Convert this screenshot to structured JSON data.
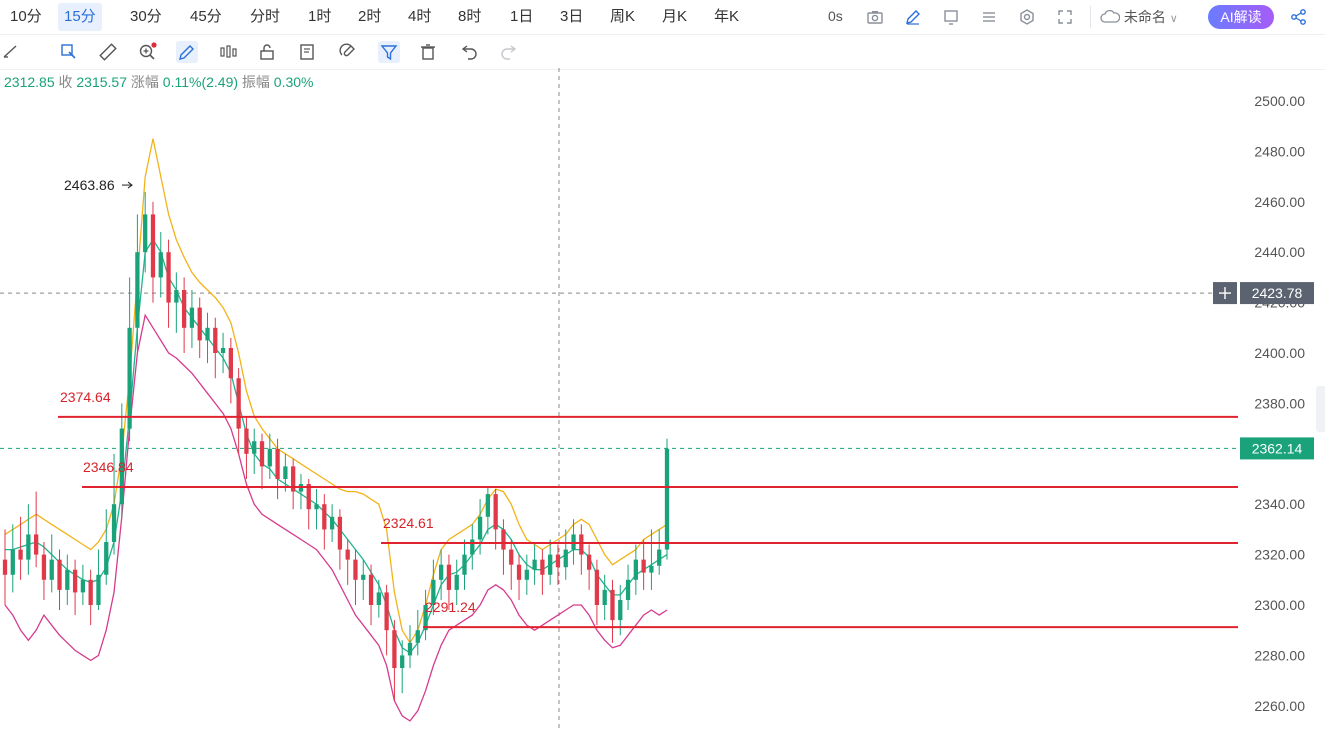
{
  "periods": [
    "10分",
    "15分",
    "30分",
    "45分",
    "分时",
    "1时",
    "2时",
    "4时",
    "8时",
    "1日",
    "3日",
    "周K",
    "月K",
    "年K"
  ],
  "active_period": "15分",
  "topbar": {
    "seconds": "0s",
    "layout_name": "未命名",
    "ai_button": "AI解读"
  },
  "info": {
    "open_value": "2312.85",
    "close_label": "收",
    "close_value": "2315.57",
    "change_label": "涨幅",
    "change_value": "0.11%(2.49)",
    "amp_label": "振幅",
    "amp_value": "0.30%"
  },
  "icons": {
    "toolbar": [
      "pointer-icon",
      "ruler-icon",
      "zoom-in-icon",
      "draw-pen-icon",
      "candle-type-icon",
      "lock-icon",
      "edit-list-icon",
      "magnet-icon",
      "filter-icon",
      "trash-icon",
      "undo-icon",
      "redo-icon"
    ],
    "topbar": [
      "camera-icon",
      "pen-icon",
      "screen-icon",
      "list-icon",
      "settings-icon",
      "fullscreen-icon",
      "cloud-icon",
      "share-icon"
    ]
  },
  "chart_data": {
    "type": "candlestick",
    "y_ticks": [
      "2500.00",
      "2480.00",
      "2460.00",
      "2440.00",
      "2420.00",
      "2400.00",
      "2380.00",
      "2360.00",
      "2340.00",
      "2320.00",
      "2300.00",
      "2280.00",
      "2260.00"
    ],
    "ylim": [
      2251,
      2514
    ],
    "current_price": "2362.14",
    "crosshair_price": "2423.78",
    "max_label": "2463.86",
    "levels": [
      {
        "value": 2374.64,
        "label": "2374.64"
      },
      {
        "value": 2346.84,
        "label": "2346.84"
      },
      {
        "value": 2324.61,
        "label": "2324.61"
      },
      {
        "value": 2291.24,
        "label": "2291.24"
      }
    ],
    "candles": [
      [
        2318,
        2312,
        2330,
        2300
      ],
      [
        2312,
        2322,
        2332,
        2305
      ],
      [
        2322,
        2318,
        2335,
        2310
      ],
      [
        2318,
        2328,
        2340,
        2312
      ],
      [
        2328,
        2320,
        2345,
        2315
      ],
      [
        2320,
        2310,
        2325,
        2302
      ],
      [
        2310,
        2318,
        2328,
        2305
      ],
      [
        2318,
        2306,
        2322,
        2298
      ],
      [
        2306,
        2314,
        2320,
        2300
      ],
      [
        2314,
        2305,
        2318,
        2296
      ],
      [
        2305,
        2310,
        2316,
        2300
      ],
      [
        2310,
        2300,
        2314,
        2292
      ],
      [
        2300,
        2312,
        2322,
        2298
      ],
      [
        2312,
        2325,
        2338,
        2308
      ],
      [
        2325,
        2340,
        2360,
        2320
      ],
      [
        2340,
        2370,
        2380,
        2335
      ],
      [
        2370,
        2410,
        2430,
        2365
      ],
      [
        2410,
        2440,
        2455,
        2400
      ],
      [
        2440,
        2455,
        2463.86,
        2432
      ],
      [
        2455,
        2430,
        2460,
        2420
      ],
      [
        2430,
        2440,
        2448,
        2422
      ],
      [
        2440,
        2420,
        2445,
        2410
      ],
      [
        2420,
        2425,
        2432,
        2408
      ],
      [
        2425,
        2410,
        2430,
        2400
      ],
      [
        2410,
        2418,
        2425,
        2402
      ],
      [
        2418,
        2405,
        2422,
        2398
      ],
      [
        2405,
        2410,
        2416,
        2396
      ],
      [
        2410,
        2400,
        2414,
        2390
      ],
      [
        2400,
        2402,
        2408,
        2392
      ],
      [
        2402,
        2390,
        2406,
        2380
      ],
      [
        2390,
        2370,
        2394,
        2360
      ],
      [
        2370,
        2360,
        2375,
        2350
      ],
      [
        2360,
        2365,
        2370,
        2352
      ],
      [
        2365,
        2355,
        2368,
        2346
      ],
      [
        2355,
        2362,
        2368,
        2350
      ],
      [
        2362,
        2350,
        2366,
        2342
      ],
      [
        2350,
        2355,
        2360,
        2345
      ],
      [
        2355,
        2345,
        2358,
        2338
      ],
      [
        2345,
        2348,
        2352,
        2338
      ],
      [
        2348,
        2338,
        2350,
        2330
      ],
      [
        2338,
        2340,
        2346,
        2330
      ],
      [
        2340,
        2330,
        2344,
        2322
      ],
      [
        2330,
        2335,
        2340,
        2325
      ],
      [
        2335,
        2322,
        2338,
        2314
      ],
      [
        2322,
        2318,
        2326,
        2308
      ],
      [
        2318,
        2310,
        2322,
        2300
      ],
      [
        2310,
        2312,
        2318,
        2302
      ],
      [
        2312,
        2300,
        2316,
        2292
      ],
      [
        2300,
        2305,
        2310,
        2295
      ],
      [
        2305,
        2290,
        2308,
        2280
      ],
      [
        2290,
        2275,
        2294,
        2262
      ],
      [
        2275,
        2280,
        2286,
        2265
      ],
      [
        2280,
        2285,
        2292,
        2275
      ],
      [
        2285,
        2290,
        2298,
        2280
      ],
      [
        2290,
        2300,
        2306,
        2286
      ],
      [
        2300,
        2310,
        2318,
        2296
      ],
      [
        2310,
        2316,
        2322,
        2302
      ],
      [
        2316,
        2306,
        2320,
        2298
      ],
      [
        2306,
        2312,
        2318,
        2300
      ],
      [
        2312,
        2320,
        2326,
        2306
      ],
      [
        2320,
        2326,
        2332,
        2314
      ],
      [
        2326,
        2335,
        2342,
        2320
      ],
      [
        2335,
        2344,
        2347,
        2328
      ],
      [
        2344,
        2330,
        2346,
        2322
      ],
      [
        2330,
        2322,
        2334,
        2312
      ],
      [
        2322,
        2316,
        2326,
        2306
      ],
      [
        2316,
        2310,
        2320,
        2302
      ],
      [
        2310,
        2314,
        2320,
        2304
      ],
      [
        2314,
        2318,
        2324,
        2308
      ],
      [
        2318,
        2312,
        2322,
        2304
      ],
      [
        2312,
        2320,
        2326,
        2308
      ],
      [
        2320,
        2315,
        2324,
        2308
      ],
      [
        2315,
        2322,
        2330,
        2310
      ],
      [
        2322,
        2328,
        2334,
        2316
      ],
      [
        2328,
        2320,
        2332,
        2312
      ],
      [
        2320,
        2314,
        2324,
        2306
      ],
      [
        2314,
        2300,
        2318,
        2292
      ],
      [
        2300,
        2306,
        2312,
        2294
      ],
      [
        2306,
        2294,
        2310,
        2285
      ],
      [
        2294,
        2302,
        2308,
        2288
      ],
      [
        2302,
        2310,
        2316,
        2298
      ],
      [
        2310,
        2318,
        2324,
        2304
      ],
      [
        2318,
        2312.85,
        2326,
        2306
      ],
      [
        2312.85,
        2315.57,
        2330,
        2306
      ],
      [
        2315.57,
        2322,
        2330,
        2312
      ],
      [
        2322,
        2362,
        2366,
        2318
      ]
    ],
    "ma_yellow": [
      2328,
      2330,
      2332,
      2334,
      2336,
      2334,
      2332,
      2330,
      2328,
      2326,
      2324,
      2322,
      2325,
      2330,
      2340,
      2360,
      2390,
      2430,
      2470,
      2485,
      2470,
      2455,
      2445,
      2438,
      2432,
      2428,
      2425,
      2422,
      2418,
      2412,
      2400,
      2385,
      2375,
      2370,
      2366,
      2362,
      2360,
      2358,
      2356,
      2354,
      2352,
      2350,
      2348,
      2346,
      2345,
      2345,
      2344,
      2342,
      2340,
      2330,
      2305,
      2290,
      2285,
      2290,
      2300,
      2312,
      2322,
      2326,
      2328,
      2330,
      2332,
      2336,
      2342,
      2346,
      2345,
      2340,
      2332,
      2326,
      2324,
      2322,
      2324,
      2326,
      2328,
      2332,
      2334,
      2332,
      2326,
      2320,
      2316,
      2318,
      2320,
      2322,
      2326,
      2328,
      2330,
      2332
    ],
    "ma_teal": [
      2322,
      2322,
      2323,
      2324,
      2325,
      2323,
      2320,
      2317,
      2314,
      2312,
      2310,
      2309,
      2310,
      2315,
      2325,
      2345,
      2375,
      2410,
      2440,
      2445,
      2440,
      2430,
      2425,
      2418,
      2414,
      2410,
      2406,
      2402,
      2398,
      2392,
      2380,
      2368,
      2360,
      2356,
      2354,
      2350,
      2348,
      2346,
      2344,
      2342,
      2340,
      2337,
      2334,
      2330,
      2326,
      2322,
      2318,
      2313,
      2308,
      2300,
      2290,
      2283,
      2281,
      2285,
      2292,
      2300,
      2308,
      2312,
      2313,
      2316,
      2320,
      2324,
      2330,
      2332,
      2330,
      2326,
      2320,
      2316,
      2314,
      2314,
      2316,
      2318,
      2320,
      2322,
      2322,
      2319,
      2312,
      2308,
      2304,
      2304,
      2308,
      2312,
      2314,
      2316,
      2318,
      2320
    ],
    "ma_magenta": [
      2300,
      2296,
      2290,
      2286,
      2290,
      2296,
      2292,
      2288,
      2285,
      2282,
      2280,
      2278,
      2280,
      2290,
      2305,
      2335,
      2370,
      2400,
      2415,
      2410,
      2405,
      2400,
      2398,
      2395,
      2392,
      2388,
      2384,
      2380,
      2376,
      2370,
      2360,
      2348,
      2340,
      2336,
      2334,
      2332,
      2330,
      2328,
      2326,
      2324,
      2322,
      2318,
      2314,
      2308,
      2302,
      2296,
      2292,
      2288,
      2284,
      2276,
      2262,
      2256,
      2254,
      2258,
      2266,
      2276,
      2284,
      2290,
      2292,
      2294,
      2296,
      2300,
      2306,
      2308,
      2306,
      2302,
      2296,
      2292,
      2290,
      2292,
      2294,
      2296,
      2298,
      2300,
      2300,
      2296,
      2290,
      2286,
      2283,
      2284,
      2288,
      2292,
      2296,
      2298,
      2296,
      2298
    ]
  }
}
